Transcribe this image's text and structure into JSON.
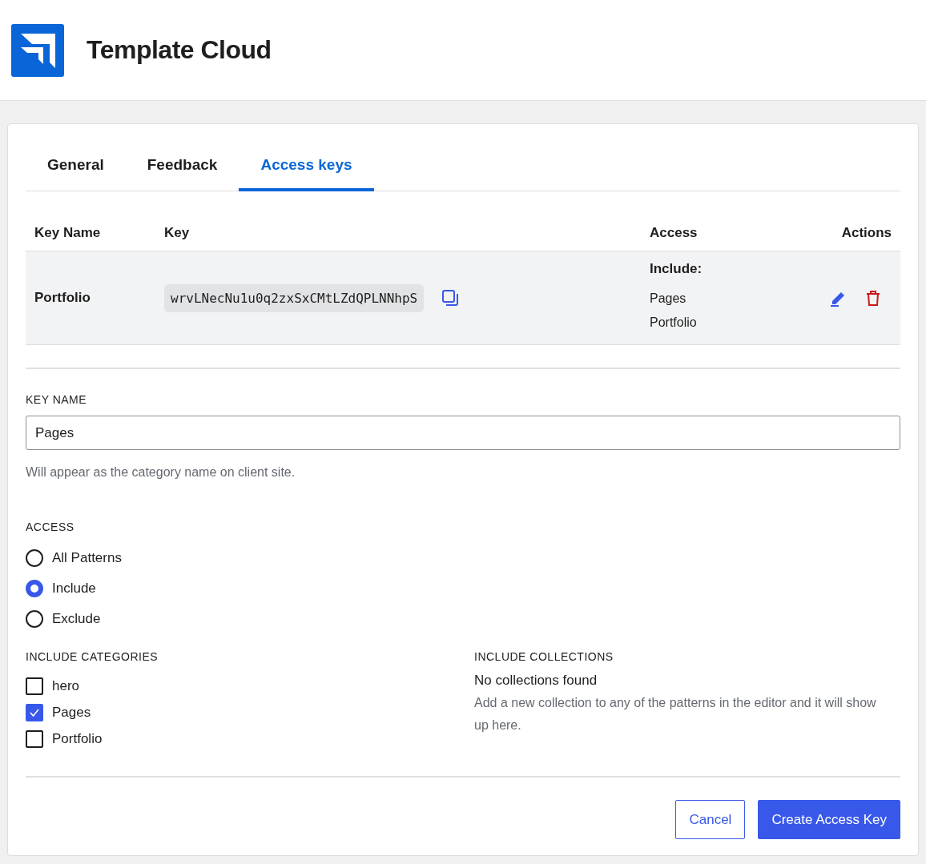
{
  "header": {
    "title": "Template Cloud"
  },
  "tabs": [
    {
      "label": "General",
      "selected": false
    },
    {
      "label": "Feedback",
      "selected": false
    },
    {
      "label": "Access keys",
      "selected": true
    }
  ],
  "table": {
    "columns": [
      "Key Name",
      "Key",
      "Access",
      "Actions"
    ],
    "rows": [
      {
        "name": "Portfolio",
        "key": "wrvLNecNu1u0q2zxSxCMtLZdQPLNNhpS",
        "access_title": "Include:",
        "access_items": [
          "Pages",
          "Portfolio"
        ]
      }
    ]
  },
  "form": {
    "key_name_label": "KEY NAME",
    "key_name_value": "Pages",
    "key_name_help": "Will appear as the category name on client site.",
    "access_label": "ACCESS",
    "access_options": [
      {
        "label": "All Patterns",
        "selected": false
      },
      {
        "label": "Include",
        "selected": true
      },
      {
        "label": "Exclude",
        "selected": false
      }
    ],
    "categories_label": "INCLUDE CATEGORIES",
    "categories": [
      {
        "label": "hero",
        "checked": false
      },
      {
        "label": "Pages",
        "checked": true
      },
      {
        "label": "Portfolio",
        "checked": false
      }
    ],
    "collections_label": "INCLUDE COLLECTIONS",
    "collections_empty": "No collections found",
    "collections_help": "Add a new collection to any of the patterns in the editor and it will show up here."
  },
  "buttons": {
    "cancel": "Cancel",
    "submit": "Create Access Key"
  }
}
